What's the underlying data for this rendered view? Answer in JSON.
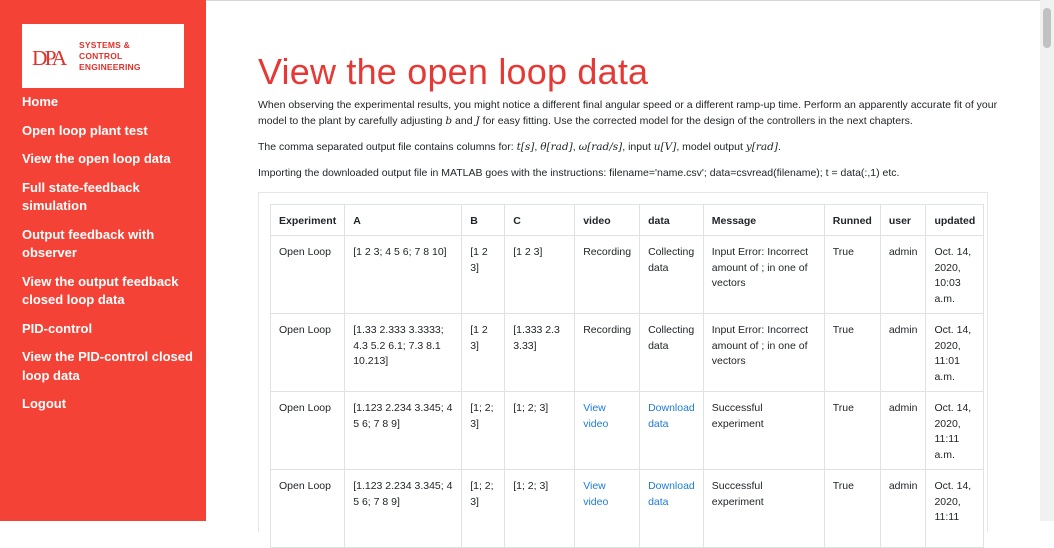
{
  "logo": {
    "mark": "DPA",
    "line1": "SYSTEMS &",
    "line2": "CONTROL ENGINEERING"
  },
  "nav": {
    "items": [
      {
        "label": "Home"
      },
      {
        "label": "Open loop plant test"
      },
      {
        "label": "View the open loop data"
      },
      {
        "label": "Full state-feedback simulation"
      },
      {
        "label": "Output feedback with observer"
      },
      {
        "label": "View the output feedback closed loop data"
      },
      {
        "label": "PID-control"
      },
      {
        "label": "View the PID-control closed loop data"
      },
      {
        "label": "Logout"
      }
    ]
  },
  "page": {
    "title": "View the open loop data",
    "intro": {
      "a": "When observing the experimental results, you might notice a different final angular speed or a different ramp-up time. Perform an apparently accurate fit of your",
      "b": "model to the plant by carefully adjusting ",
      "b_var": "b",
      "and": " and ",
      "j_var": "J",
      "c": " for easy fitting. Use the corrected model for the design of the controllers in the next chapters."
    },
    "columns_text": {
      "lead": "The comma separated output file contains columns for: ",
      "t": "t[s]",
      "theta": "θ[rad]",
      "omega": "ω[rad/s]",
      "input_lead": ", input ",
      "u": "u[V]",
      "output_lead": ", model output ",
      "y": "y[rad]",
      "sep": ", ",
      "end": "."
    },
    "matlab_text": "Importing the downloaded output file in MATLAB goes with the instructions: filename='name.csv'; data=csvread(filename); t = data(:,1) etc."
  },
  "table": {
    "headers": {
      "experiment": "Experiment",
      "a": "A",
      "b": "B",
      "c": "C",
      "video": "video",
      "data": "data",
      "message": "Message",
      "runned": "Runned",
      "user": "user",
      "updated": "updated"
    },
    "rows": [
      {
        "experiment": "Open Loop",
        "a": "[1 2 3; 4 5 6; 7 8 10]",
        "b": "[1 2 3]",
        "c": "[1 2 3]",
        "video": "Recording",
        "data": "Collecting data",
        "message": "Input Error: Incorrect amount of ; in one of vectors",
        "runned": "True",
        "user": "admin",
        "updated": "Oct. 14, 2020, 10:03 a.m."
      },
      {
        "experiment": "Open Loop",
        "a": "[1.33 2.333 3.3333; 4.3 5.2 6.1; 7.3 8.1 10.213]",
        "b": "[1 2 3]",
        "c": "[1.333 2.3 3.33]",
        "video": "Recording",
        "data": "Collecting data",
        "message": "Input Error: Incorrect amount of ; in one of vectors",
        "runned": "True",
        "user": "admin",
        "updated": "Oct. 14, 2020, 11:01 a.m."
      },
      {
        "experiment": "Open Loop",
        "a": "[1.123 2.234 3.345; 4 5 6; 7 8 9]",
        "b": "[1; 2; 3]",
        "c": "[1; 2; 3]",
        "video": "View video",
        "data": "Download data",
        "message": "Successful experiment",
        "runned": "True",
        "user": "admin",
        "updated": "Oct. 14, 2020, 11:11 a.m."
      },
      {
        "experiment": "Open Loop",
        "a": "[1.123 2.234 3.345; 4 5 6; 7 8 9]",
        "b": "[1; 2; 3]",
        "c": "[1; 2; 3]",
        "video": "View video",
        "data": "Download data",
        "message": "Successful experiment",
        "runned": "True",
        "user": "admin",
        "updated": "Oct. 14, 2020, 11:11"
      }
    ]
  },
  "colors": {
    "sidebar": "#f44336",
    "title": "#e53935",
    "link": "#1e7bd8"
  }
}
